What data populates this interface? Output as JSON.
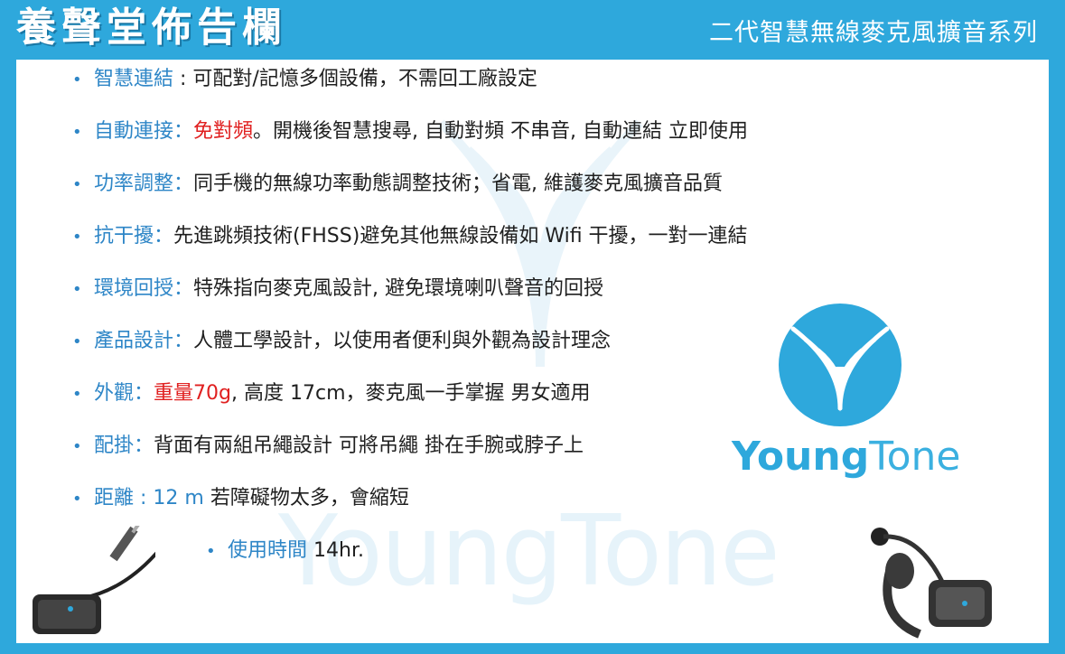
{
  "header": {
    "title": "養聲堂佈告欄",
    "subtitle": "二代智慧無線麥克風擴音系列"
  },
  "items": [
    {
      "label": "智慧連結",
      "sep": " : ",
      "red": "",
      "text": "可配對/記憶多個設備，不需回工廠設定"
    },
    {
      "label": "自動連接",
      "sep": "：",
      "red": "免對頻",
      "text": "。開機後智慧搜尋, 自動對頻 不串音, 自動連結  立即使用"
    },
    {
      "label": "功率調整",
      "sep": "：",
      "red": "",
      "text": "同手機的無線功率動態調整技術；省電, 維護麥克風擴音品質"
    },
    {
      "label": "抗干擾",
      "sep": "：",
      "red": "",
      "text": "先進跳頻技術(FHSS)避免其他無線設備如 Wifi 干擾，一對一連結"
    },
    {
      "label": "環境回授",
      "sep": "：",
      "red": "",
      "text": "特殊指向麥克風設計, 避免環境喇叭聲音的回授"
    },
    {
      "label": "產品設計",
      "sep": "：",
      "red": "",
      "text": "人體工學設計，以使用者便利與外觀為設計理念"
    },
    {
      "label": "外觀",
      "sep": "：",
      "red": "重量70g",
      "text": ", 高度 17cm，麥克風一手掌握 男女適用"
    },
    {
      "label": "配掛",
      "sep": "：",
      "red": "",
      "text": "背面有兩組吊繩設計 可將吊繩 掛在手腕或脖子上"
    },
    {
      "label": "距離",
      "sep": " : 12 m ",
      "red": "",
      "text": "若障礙物太多，會縮短"
    },
    {
      "label": "使用時間",
      "sep": " ",
      "red": "",
      "text": "14hr."
    }
  ],
  "brand": {
    "bold": "Young",
    "thin": "Tone"
  },
  "watermark": {
    "bold": "Young",
    "thin": "Tone"
  },
  "colors": {
    "frame": "#2ea8dc",
    "label": "#2e86c7",
    "highlight": "#e02020"
  },
  "icons": [
    "young-tone-logo-icon",
    "adapter-device-icon",
    "headset-mic-icon"
  ]
}
